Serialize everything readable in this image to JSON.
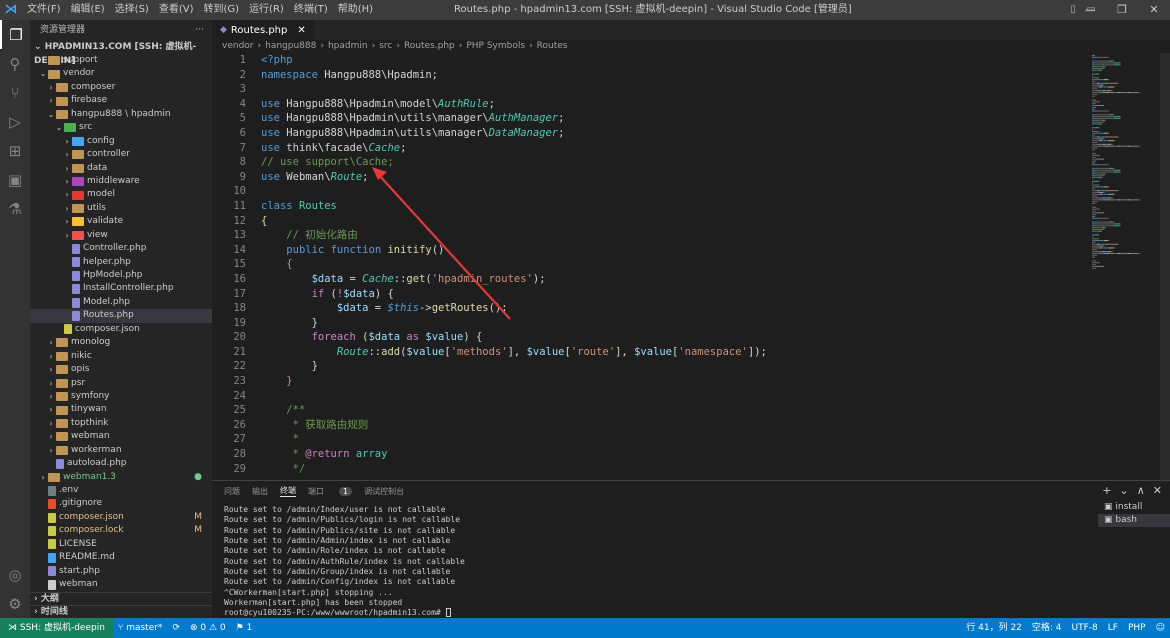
{
  "menubar": {
    "items": [
      "文件(F)",
      "编辑(E)",
      "选择(S)",
      "查看(V)",
      "转到(G)",
      "运行(R)",
      "终端(T)",
      "帮助(H)"
    ],
    "window_title": "Routes.php - hpadmin13.com [SSH: 虚拟机-deepin] - Visual Studio Code [管理员]"
  },
  "sidebar": {
    "title": "资源管理器",
    "more": "···",
    "root": "HPADMIN13.COM [SSH: 虚拟机-DEEPIN]",
    "tree": [
      {
        "label": "support",
        "depth": 1,
        "type": "folder",
        "open": false,
        "color": "#c09553"
      },
      {
        "label": "vendor",
        "depth": 1,
        "type": "folder",
        "open": true,
        "color": "#c09553"
      },
      {
        "label": "composer",
        "depth": 2,
        "type": "folder",
        "open": false,
        "color": "#c09553"
      },
      {
        "label": "firebase",
        "depth": 2,
        "type": "folder",
        "open": false,
        "color": "#c09553"
      },
      {
        "label": "hangpu888 \\ hpadmin",
        "depth": 2,
        "type": "folder",
        "open": true,
        "color": "#c09553"
      },
      {
        "label": "src",
        "depth": 3,
        "type": "folder",
        "open": true,
        "color": "#4caf50"
      },
      {
        "label": "config",
        "depth": 4,
        "type": "folder",
        "open": false,
        "color": "#42a5f5"
      },
      {
        "label": "controller",
        "depth": 4,
        "type": "folder",
        "open": false,
        "color": "#c09553"
      },
      {
        "label": "data",
        "depth": 4,
        "type": "folder",
        "open": false,
        "color": "#c09553"
      },
      {
        "label": "middleware",
        "depth": 4,
        "type": "folder",
        "open": false,
        "color": "#ab47bc"
      },
      {
        "label": "model",
        "depth": 4,
        "type": "folder",
        "open": false,
        "color": "#e53935"
      },
      {
        "label": "utils",
        "depth": 4,
        "type": "folder",
        "open": false,
        "color": "#c09553"
      },
      {
        "label": "validate",
        "depth": 4,
        "type": "folder",
        "open": false,
        "color": "#fbc02d"
      },
      {
        "label": "view",
        "depth": 4,
        "type": "folder",
        "open": false,
        "color": "#ef5350"
      },
      {
        "label": "Controller.php",
        "depth": 4,
        "type": "file",
        "color": "#8a8ad8"
      },
      {
        "label": "helper.php",
        "depth": 4,
        "type": "file",
        "color": "#8a8ad8"
      },
      {
        "label": "HpModel.php",
        "depth": 4,
        "type": "file",
        "color": "#8a8ad8"
      },
      {
        "label": "InstallController.php",
        "depth": 4,
        "type": "file",
        "color": "#8a8ad8"
      },
      {
        "label": "Model.php",
        "depth": 4,
        "type": "file",
        "color": "#8a8ad8"
      },
      {
        "label": "Routes.php",
        "depth": 4,
        "type": "file",
        "color": "#8a8ad8",
        "selected": true
      },
      {
        "label": "composer.json",
        "depth": 3,
        "type": "file",
        "color": "#cbcb41"
      },
      {
        "label": "monolog",
        "depth": 2,
        "type": "folder",
        "open": false,
        "color": "#c09553"
      },
      {
        "label": "nikic",
        "depth": 2,
        "type": "folder",
        "open": false,
        "color": "#c09553"
      },
      {
        "label": "opis",
        "depth": 2,
        "type": "folder",
        "open": false,
        "color": "#c09553"
      },
      {
        "label": "psr",
        "depth": 2,
        "type": "folder",
        "open": false,
        "color": "#c09553"
      },
      {
        "label": "symfony",
        "depth": 2,
        "type": "folder",
        "open": false,
        "color": "#c09553"
      },
      {
        "label": "tinywan",
        "depth": 2,
        "type": "folder",
        "open": false,
        "color": "#c09553"
      },
      {
        "label": "topthink",
        "depth": 2,
        "type": "folder",
        "open": false,
        "color": "#c09553"
      },
      {
        "label": "webman",
        "depth": 2,
        "type": "folder",
        "open": false,
        "color": "#c09553"
      },
      {
        "label": "workerman",
        "depth": 2,
        "type": "folder",
        "open": false,
        "color": "#c09553"
      },
      {
        "label": "autoload.php",
        "depth": 2,
        "type": "file",
        "color": "#8a8ad8"
      },
      {
        "label": "webman1.3",
        "depth": 1,
        "type": "folder",
        "open": false,
        "color": "#c09553",
        "text_color": "#73c991",
        "badge": "●",
        "badge_color": "#73c991"
      },
      {
        "label": ".env",
        "depth": 1,
        "type": "file",
        "color": "#6d8086"
      },
      {
        "label": ".gitignore",
        "depth": 1,
        "type": "file",
        "color": "#e44d26"
      },
      {
        "label": "composer.json",
        "depth": 1,
        "type": "file",
        "color": "#cbcb41",
        "text_color": "#e2c08d",
        "badge": "M",
        "badge_color": "#e2c08d"
      },
      {
        "label": "composer.lock",
        "depth": 1,
        "type": "file",
        "color": "#cbcb41",
        "text_color": "#e2c08d",
        "badge": "M",
        "badge_color": "#e2c08d"
      },
      {
        "label": "LICENSE",
        "depth": 1,
        "type": "file",
        "color": "#cbcb41"
      },
      {
        "label": "README.md",
        "depth": 1,
        "type": "file",
        "color": "#42a5f5"
      },
      {
        "label": "start.php",
        "depth": 1,
        "type": "file",
        "color": "#8a8ad8"
      },
      {
        "label": "webman",
        "depth": 1,
        "type": "file",
        "color": "#cccccc"
      }
    ],
    "section_outline": "大纲",
    "section_timeline": "时间线"
  },
  "editor": {
    "tab_label": "Routes.php",
    "breadcrumb": [
      "vendor",
      "hangpu888",
      "hpadmin",
      "src",
      "Routes.php",
      "PHP Symbols",
      "Routes"
    ],
    "lines": [
      [
        [
          "kw",
          "<?php"
        ]
      ],
      [
        [
          "kw",
          "namespace "
        ],
        [
          "wh",
          "Hangpu888\\Hpadmin;"
        ]
      ],
      [],
      [
        [
          "kw",
          "use "
        ],
        [
          "wh",
          "Hangpu888\\Hpadmin\\model\\"
        ],
        [
          "it",
          "AuthRule"
        ],
        [
          "wh",
          ";"
        ]
      ],
      [
        [
          "kw",
          "use "
        ],
        [
          "wh",
          "Hangpu888\\Hpadmin\\utils\\manager\\"
        ],
        [
          "it",
          "AuthManager"
        ],
        [
          "wh",
          ";"
        ]
      ],
      [
        [
          "kw",
          "use "
        ],
        [
          "wh",
          "Hangpu888\\Hpadmin\\utils\\manager\\"
        ],
        [
          "it",
          "DataManager"
        ],
        [
          "wh",
          ";"
        ]
      ],
      [
        [
          "kw",
          "use "
        ],
        [
          "wh",
          "think\\facade\\"
        ],
        [
          "it",
          "Cache"
        ],
        [
          "wh",
          ";"
        ]
      ],
      [
        [
          "cm",
          "// use support\\Cache;"
        ]
      ],
      [
        [
          "kw",
          "use "
        ],
        [
          "wh",
          "Webman\\"
        ],
        [
          "it",
          "Route"
        ],
        [
          "wh",
          ";"
        ]
      ],
      [],
      [
        [
          "kw",
          "class "
        ],
        [
          "cls",
          "Routes"
        ]
      ],
      [
        [
          "fn",
          "{"
        ]
      ],
      [
        [
          "wh",
          "    "
        ],
        [
          "cm",
          "// 初始化路由"
        ]
      ],
      [
        [
          "wh",
          "    "
        ],
        [
          "kw",
          "public "
        ],
        [
          "kw",
          "function "
        ],
        [
          "fn",
          "initify"
        ],
        [
          "wh",
          "()"
        ]
      ],
      [
        [
          "wh",
          "    "
        ],
        [
          "ctl",
          "{"
        ]
      ],
      [
        [
          "wh",
          "        "
        ],
        [
          "var",
          "$data"
        ],
        [
          "wh",
          " = "
        ],
        [
          "it",
          "Cache"
        ],
        [
          "wh",
          "::"
        ],
        [
          "fn",
          "get"
        ],
        [
          "wh",
          "("
        ],
        [
          "str",
          "'hpadmin_routes'"
        ],
        [
          "wh",
          ");"
        ]
      ],
      [
        [
          "wh",
          "        "
        ],
        [
          "ctl",
          "if "
        ],
        [
          "wh",
          "("
        ],
        [
          "ctl",
          "!"
        ],
        [
          "var",
          "$data"
        ],
        [
          "wh",
          ") {"
        ]
      ],
      [
        [
          "wh",
          "            "
        ],
        [
          "var",
          "$data"
        ],
        [
          "wh",
          " = "
        ],
        [
          "this",
          "$this"
        ],
        [
          "wh",
          "->"
        ],
        [
          "fn",
          "getRoutes"
        ],
        [
          "wh",
          "();"
        ]
      ],
      [
        [
          "wh",
          "        }"
        ]
      ],
      [
        [
          "wh",
          "        "
        ],
        [
          "ctl",
          "foreach "
        ],
        [
          "wh",
          "("
        ],
        [
          "var",
          "$data"
        ],
        [
          "ctl",
          " as "
        ],
        [
          "var",
          "$value"
        ],
        [
          "wh",
          ") {"
        ]
      ],
      [
        [
          "wh",
          "            "
        ],
        [
          "it",
          "Route"
        ],
        [
          "wh",
          "::"
        ],
        [
          "fn",
          "add"
        ],
        [
          "wh",
          "("
        ],
        [
          "var",
          "$value"
        ],
        [
          "wh",
          "["
        ],
        [
          "str",
          "'methods'"
        ],
        [
          "wh",
          "], "
        ],
        [
          "var",
          "$value"
        ],
        [
          "wh",
          "["
        ],
        [
          "str",
          "'route'"
        ],
        [
          "wh",
          "], "
        ],
        [
          "var",
          "$value"
        ],
        [
          "wh",
          "["
        ],
        [
          "str",
          "'namespace'"
        ],
        [
          "wh",
          "]);"
        ]
      ],
      [
        [
          "wh",
          "        }"
        ]
      ],
      [
        [
          "wh",
          "    "
        ],
        [
          "ctl",
          "}"
        ]
      ],
      [],
      [
        [
          "wh",
          "    "
        ],
        [
          "cm",
          "/**"
        ]
      ],
      [
        [
          "wh",
          "     "
        ],
        [
          "cm",
          "* 获取路由规则"
        ]
      ],
      [
        [
          "wh",
          "     "
        ],
        [
          "cm",
          "*"
        ]
      ],
      [
        [
          "wh",
          "     "
        ],
        [
          "cm",
          "* "
        ],
        [
          "ctl",
          "@return "
        ],
        [
          "cls",
          "array"
        ]
      ],
      [
        [
          "wh",
          "     "
        ],
        [
          "cm",
          "*/"
        ]
      ]
    ]
  },
  "panel": {
    "tabs": [
      "问题",
      "输出",
      "终端",
      "端口",
      "调试控制台"
    ],
    "ports_count": "1",
    "active_tab": "终端",
    "terminal_lines": [
      "Route set to /admin/Index/user is not callable",
      "Route set to /admin/Publics/login is not callable",
      "Route set to /admin/Publics/site is not callable",
      "Route set to /admin/Admin/index is not callable",
      "Route set to /admin/Role/index is not callable",
      "Route set to /admin/AuthRule/index is not callable",
      "Route set to /admin/Group/index is not callable",
      "Route set to /admin/Config/index is not callable",
      "^CWorkerman[start.php] stopping ...",
      "Workerman[start.php] has been stopped",
      "root@cyu100235-PC:/www/wwwroot/hpadmin13.com# "
    ],
    "terminal_list": [
      "install",
      "bash"
    ],
    "actions": [
      "+",
      "⌄",
      "∧",
      "✕"
    ]
  },
  "statusbar": {
    "remote": "SSH: 虚拟机-deepin",
    "branch": "master*",
    "sync": "⟳",
    "problems": "⊗ 0 ⚠ 0",
    "ports": "⚑ 1",
    "position": "行 41，列 22",
    "spaces": "空格: 4",
    "encoding": "UTF-8",
    "eol": "LF",
    "language": "PHP"
  },
  "colors": {
    "accent": "#007acc",
    "arrow": "#e53935"
  }
}
